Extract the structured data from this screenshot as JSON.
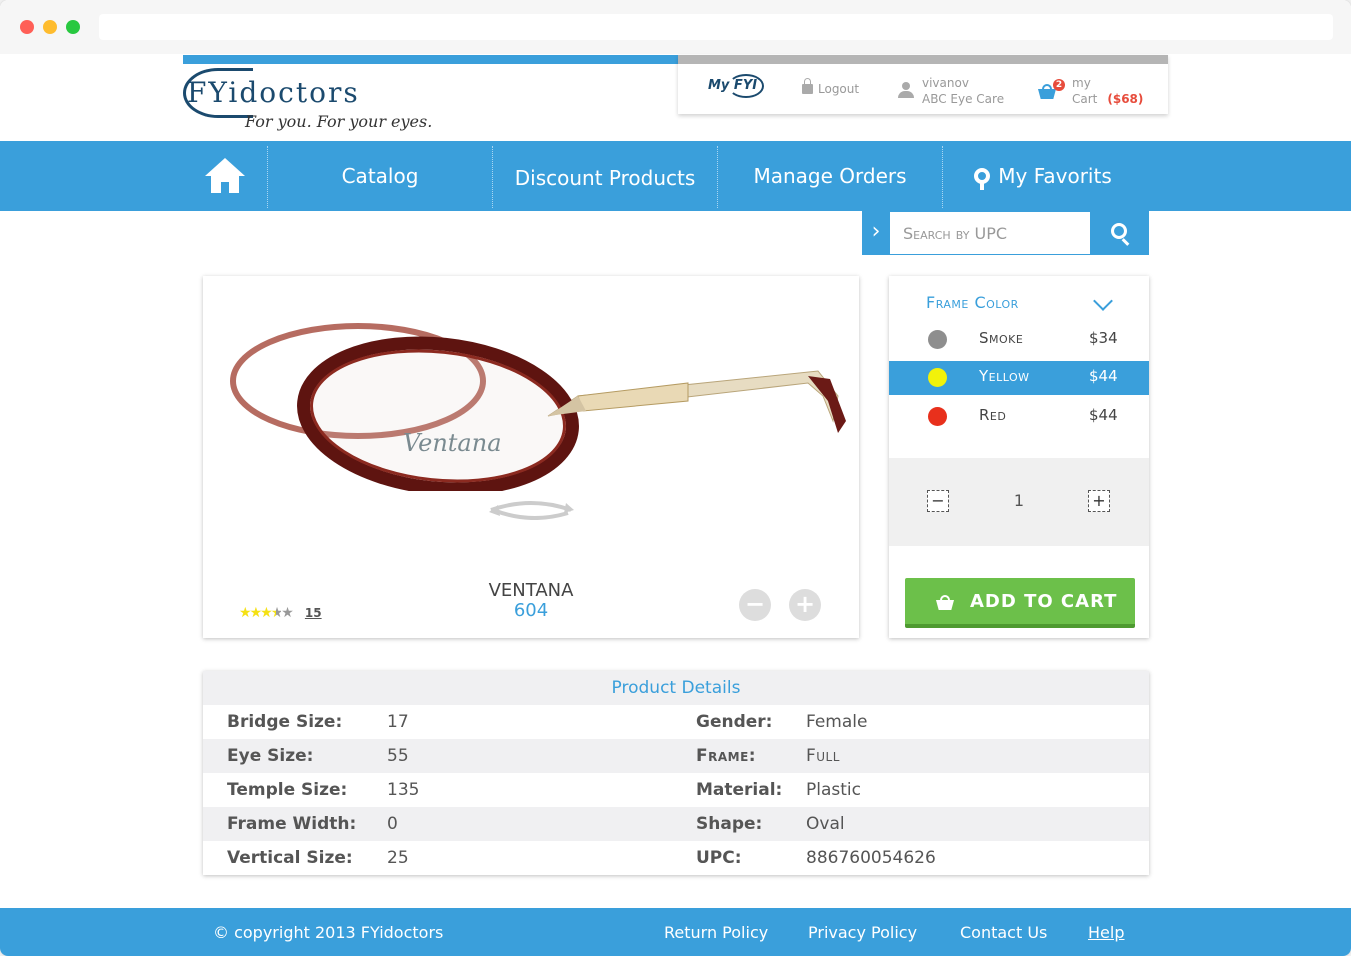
{
  "header": {
    "logo_text": "FYidoctors",
    "logo_tagline": "For you. For your eyes.",
    "myfyi_label": "My FYI",
    "logout_label": "Logout",
    "user": {
      "username": "vivanov",
      "company": "ABC Eye Care"
    },
    "cart": {
      "badge_count": "2",
      "line1": "my",
      "line2": "Cart",
      "amount": "($68)"
    }
  },
  "nav": {
    "items": [
      {
        "label": "Catalog"
      },
      {
        "label": "Discount Products"
      },
      {
        "label": "Manage Orders"
      },
      {
        "label": "My Favorits"
      }
    ]
  },
  "search": {
    "placeholder": "Search by UPC"
  },
  "product": {
    "brand": "VENTANA",
    "model": "604",
    "image_brand_text": "Ventana",
    "rating": 3.5,
    "review_count": "15"
  },
  "options": {
    "heading": "Frame Color",
    "colors": [
      {
        "name": "Smoke",
        "price": "$34",
        "swatch": "#8e8e8e"
      },
      {
        "name": "Yellow",
        "price": "$44",
        "swatch": "#f2f20a"
      },
      {
        "name": "Red",
        "price": "$44",
        "swatch": "#e8301c"
      }
    ],
    "selected_index": 1,
    "quantity": "1",
    "add_to_cart_label": "ADD TO CART"
  },
  "details": {
    "title": "Product Details",
    "left": [
      {
        "label": "Bridge Size:",
        "value": "17"
      },
      {
        "label": "Eye Size:",
        "value": "55"
      },
      {
        "label": "Temple Size:",
        "value": "135"
      },
      {
        "label": "Frame Width:",
        "value": "0"
      },
      {
        "label": "Vertical Size:",
        "value": "25"
      }
    ],
    "right": [
      {
        "label": "Gender:",
        "value": "Female"
      },
      {
        "label": "Frame:",
        "value": "Full"
      },
      {
        "label": "Material:",
        "value": "Plastic"
      },
      {
        "label": "Shape:",
        "value": "Oval"
      },
      {
        "label": "UPC:",
        "value": "886760054626"
      }
    ]
  },
  "footer": {
    "copyright": "© copyright 2013 FYidoctors",
    "links": [
      "Return Policy",
      "Privacy Policy",
      "Contact Us",
      "Help"
    ]
  },
  "colors": {
    "primary_blue": "#3a9fdb",
    "cart_red": "#e74c3c",
    "add_green": "#6cc04a"
  }
}
